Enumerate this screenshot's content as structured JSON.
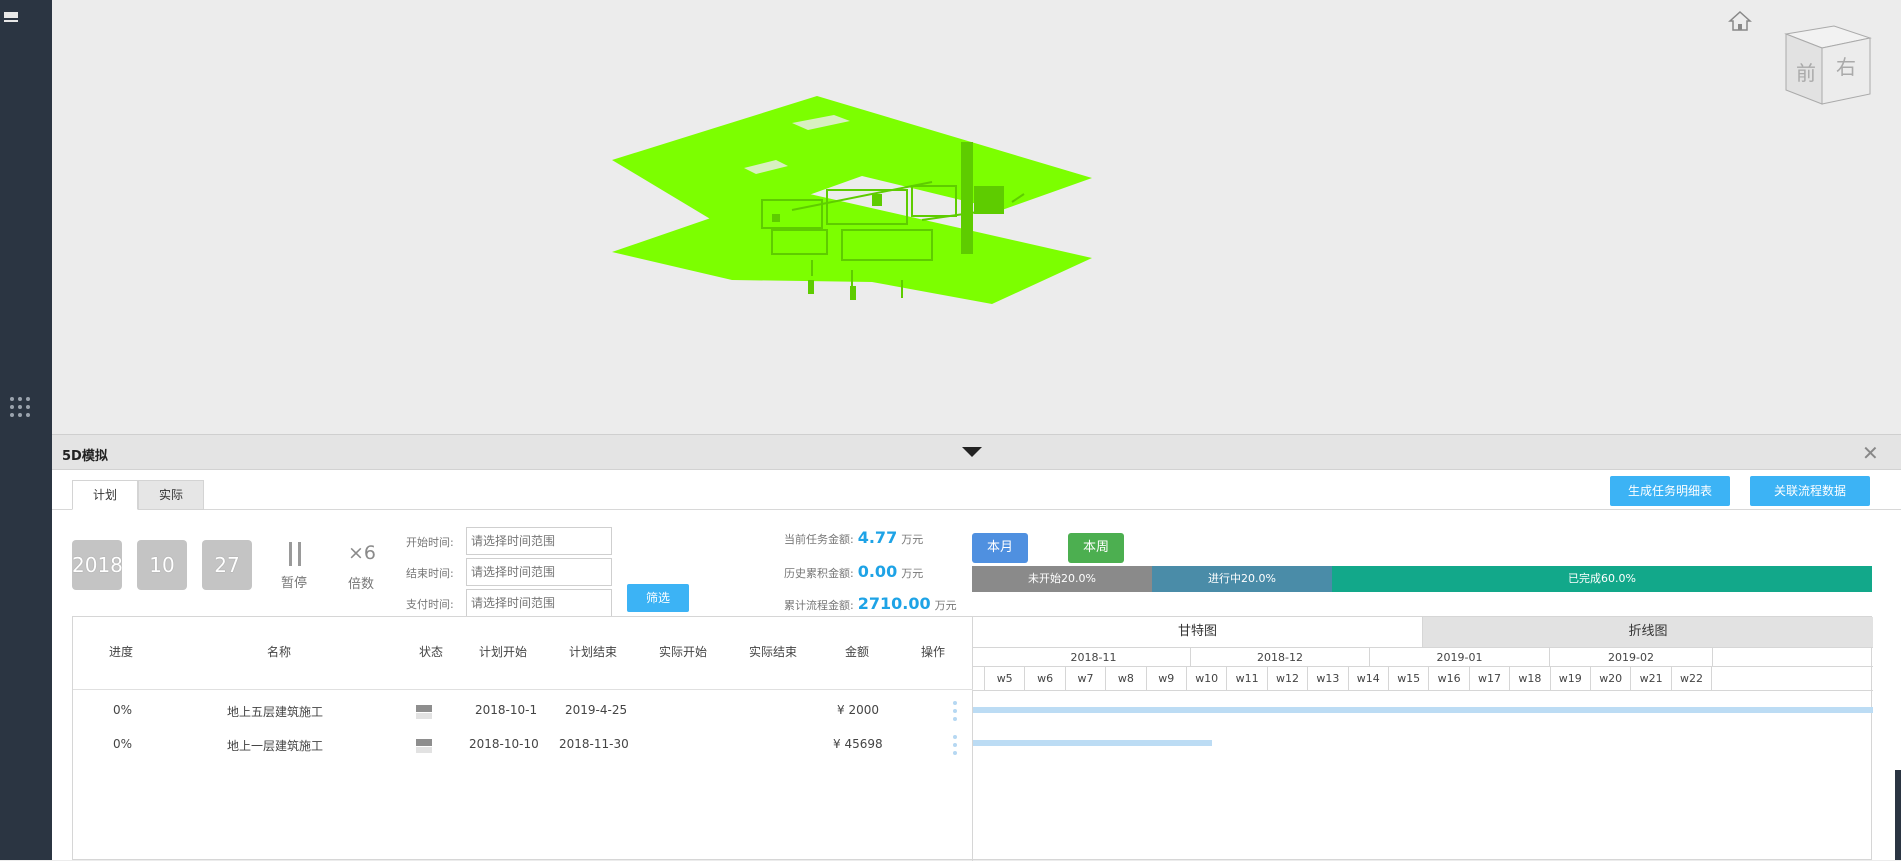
{
  "panel": {
    "title": "5D模拟"
  },
  "tabs": [
    {
      "label": "计划"
    },
    {
      "label": "实际"
    }
  ],
  "actions": {
    "generate_label": "生成任务明细表",
    "link_label": "关联流程数据"
  },
  "playback": {
    "year": "2018",
    "month": "10",
    "day": "27",
    "pause_glyph": "||",
    "pause_label": "暂停",
    "speed_value": "×6",
    "speed_label": "倍数"
  },
  "filters": {
    "start_label": "开始时间:",
    "end_label": "结束时间:",
    "pay_label": "支付时间:",
    "placeholder": "请选择时间范围",
    "filter_button": "筛选"
  },
  "amounts": {
    "current_label": "当前任务金额:",
    "current_value": "4.77",
    "current_unit": "万元",
    "history_label": "历史累积金额:",
    "history_value": "0.00",
    "history_unit": "万元",
    "process_label": "累计流程金额:",
    "process_value": "2710.00",
    "process_unit": "万元"
  },
  "period": {
    "month_button": "本月",
    "week_button": "本周"
  },
  "progress": {
    "segments": [
      {
        "label": "未开始20.0%",
        "percent": 20.0,
        "color": "#8a8a8a"
      },
      {
        "label": "进行中20.0%",
        "percent": 20.0,
        "color": "#4a8ca8"
      },
      {
        "label": "已完成60.0%",
        "percent": 60.0,
        "color": "#12a88a"
      }
    ]
  },
  "table": {
    "columns": [
      "进度",
      "名称",
      "状态",
      "计划开始",
      "计划结束",
      "实际开始",
      "实际结束",
      "金额",
      "操作"
    ],
    "rows": [
      {
        "progress": "0%",
        "name": "地上五层建筑施工",
        "plan_start": "2018-10-1",
        "plan_end": "2019-4-25",
        "actual_start": "",
        "actual_end": "",
        "amount": "¥ 2000"
      },
      {
        "progress": "0%",
        "name": "地上一层建筑施工",
        "plan_start": "2018-10-10",
        "plan_end": "2018-11-30",
        "actual_start": "",
        "actual_end": "",
        "amount": "¥ 45698"
      }
    ]
  },
  "gantt": {
    "tabs": [
      {
        "label": "甘特图"
      },
      {
        "label": "折线图"
      }
    ],
    "months": [
      "2018-11",
      "2018-12",
      "2019-01",
      "2019-02"
    ],
    "weeks": [
      "w5",
      "w6",
      "w7",
      "w8",
      "w9",
      "w10",
      "w11",
      "w12",
      "w13",
      "w14",
      "w15",
      "w16",
      "w17",
      "w18",
      "w19",
      "w20",
      "w21",
      "w22"
    ],
    "bars": [
      {
        "task": "地上五层建筑施工",
        "start_fraction": 0.0,
        "end_fraction": 1.0
      },
      {
        "task": "地上一层建筑施工",
        "start_fraction": 0.0,
        "end_fraction": 0.265
      }
    ]
  },
  "viewcube": {
    "face_front": "前",
    "face_right": "右"
  }
}
